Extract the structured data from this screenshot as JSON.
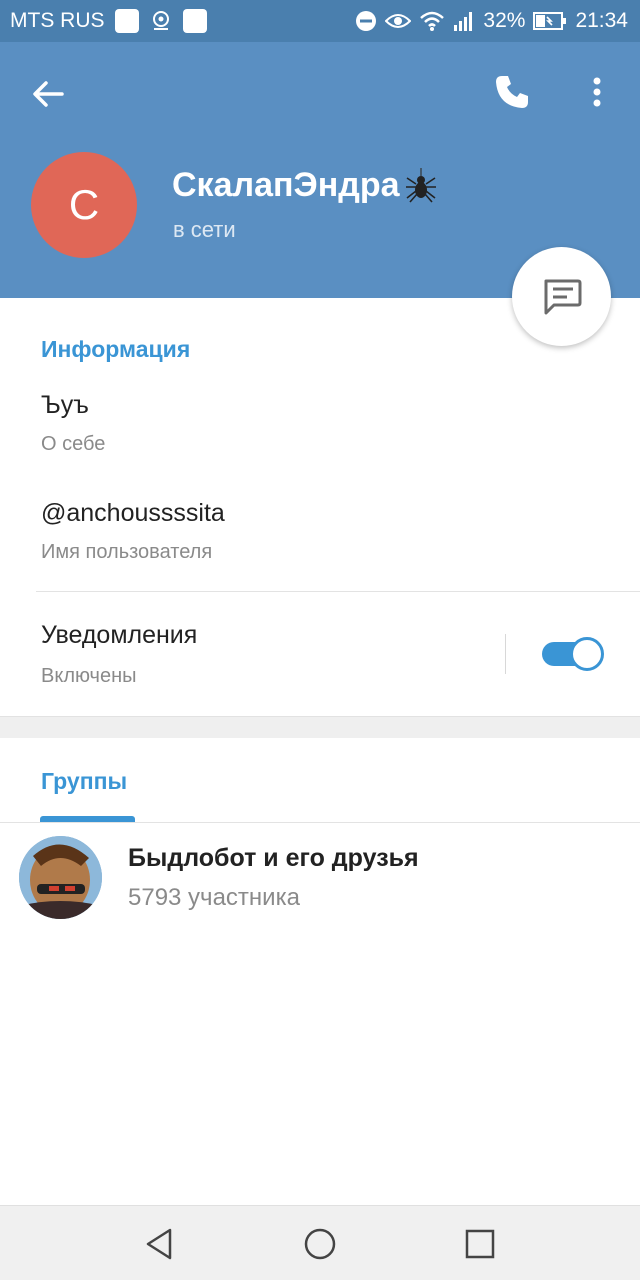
{
  "status_bar": {
    "carrier": "MTS RUS",
    "battery": "32%",
    "time": "21:34"
  },
  "header": {
    "avatar_letter": "С",
    "name": "СкалапЭндра",
    "status": "в сети",
    "colors": {
      "header": "#5a8fc2",
      "avatar": "#e06757",
      "accent": "#3a95d5"
    }
  },
  "info": {
    "title": "Информация",
    "bio_value": "Ъуъ",
    "bio_label": "О себе",
    "username_value": "@anchoussssita",
    "username_label": "Имя пользователя",
    "notifications_value": "Уведомления",
    "notifications_label": "Включены",
    "notifications_enabled": true
  },
  "groups": {
    "tab_label": "Группы",
    "items": [
      {
        "name": "Быдлобот и его друзья",
        "members": "5793 участника"
      }
    ]
  },
  "icons": [
    "back-arrow-icon",
    "phone-icon",
    "more-vert-icon",
    "message-icon",
    "spider-emoji-icon",
    "nav-back-icon",
    "nav-home-icon",
    "nav-recents-icon"
  ]
}
